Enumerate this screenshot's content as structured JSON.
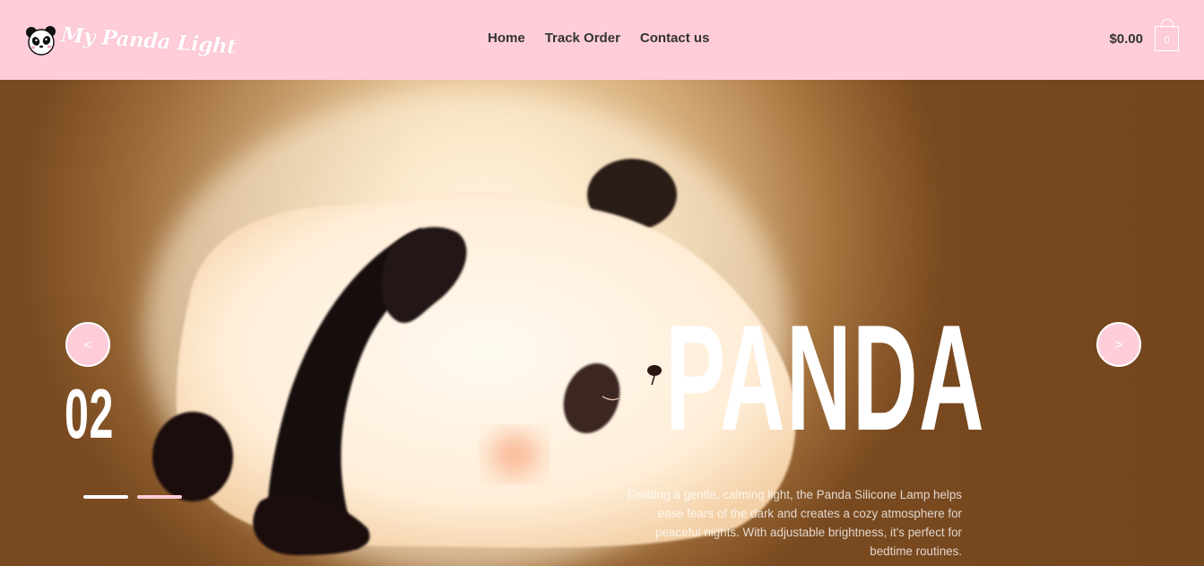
{
  "brand": {
    "logo_text": "My Panda Light",
    "logo_icon": "panda-face-icon"
  },
  "nav": {
    "items": [
      "Home",
      "Track Order",
      "Contact us"
    ]
  },
  "cart": {
    "total": "$0.00",
    "count": "0",
    "icon": "shopping-bag-icon"
  },
  "hero": {
    "prev_label": "<",
    "next_label": ">",
    "slide_number": "02",
    "headline": "PANDA",
    "description": "Emitting a gentle, calming light, the Panda Silicone Lamp helps ease fears of the dark and creates a cozy atmosphere for peaceful nights. With adjustable brightness, it's perfect for bedtime routines.",
    "slides": [
      {
        "active": true
      },
      {
        "active": false
      }
    ]
  },
  "colors": {
    "header_bg": "#ffcdd9",
    "accent": "#ffcdd9",
    "text_dark": "#333333",
    "white": "#ffffff"
  }
}
